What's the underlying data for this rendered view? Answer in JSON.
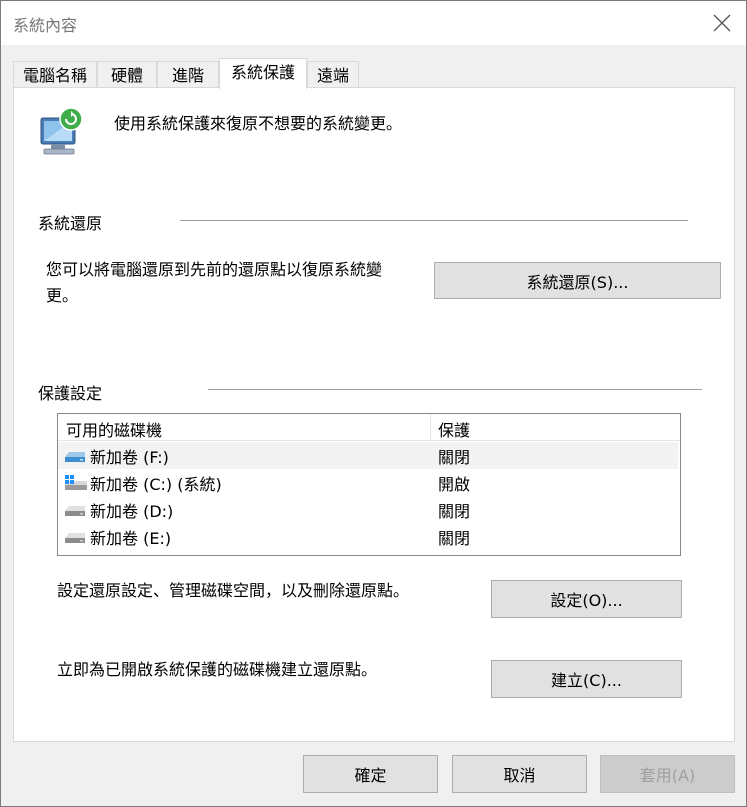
{
  "window": {
    "title": "系統內容"
  },
  "tabs": [
    {
      "label": "電腦名稱"
    },
    {
      "label": "硬體"
    },
    {
      "label": "進階"
    },
    {
      "label": "系統保護"
    },
    {
      "label": "遠端"
    }
  ],
  "intro": {
    "text": "使用系統保護來復原不想要的系統變更。"
  },
  "system_restore": {
    "group_title": "系統還原",
    "description_line1": "您可以將電腦還原到先前的還原點以復原系統變",
    "description_line2": "更。",
    "button_label": "系統還原(S)..."
  },
  "protection_settings": {
    "group_title": "保護設定",
    "columns": {
      "drive": "可用的磁碟機",
      "protection": "保護"
    },
    "drives": [
      {
        "name": "新加卷 (F:)",
        "protection": "關閉",
        "icon": "drive-icon",
        "selected": true
      },
      {
        "name": "新加卷 (C:) (系統)",
        "protection": "開啟",
        "icon": "system-drive-icon",
        "selected": false
      },
      {
        "name": "新加卷 (D:)",
        "protection": "關閉",
        "icon": "drive-icon",
        "selected": false
      },
      {
        "name": "新加卷 (E:)",
        "protection": "關閉",
        "icon": "drive-icon",
        "selected": false
      }
    ],
    "configure_text": "設定還原設定、管理磁碟空間，以及刪除還原點。",
    "configure_button": "設定(O)...",
    "create_text": "立即為已開啟系統保護的磁碟機建立還原點。",
    "create_button": "建立(C)..."
  },
  "footer": {
    "ok_label": "確定",
    "cancel_label": "取消",
    "apply_label": "套用(A)"
  }
}
